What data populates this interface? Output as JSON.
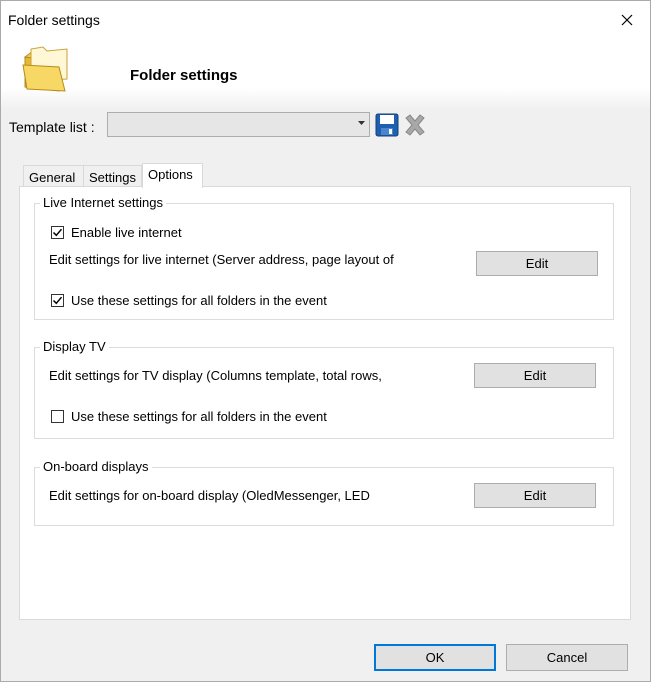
{
  "window": {
    "title": "Folder settings",
    "close_icon": "close-icon"
  },
  "header": {
    "icon": "folder-icon",
    "title": "Folder settings"
  },
  "template": {
    "label": "Template list :",
    "value": "",
    "save_icon": "save-icon",
    "delete_icon": "delete-icon"
  },
  "tabs": [
    {
      "label": "General",
      "active": false
    },
    {
      "label": "Settings",
      "active": false
    },
    {
      "label": "Options",
      "active": true
    }
  ],
  "live_internet": {
    "legend": "Live Internet settings",
    "enable_label": "Enable live internet",
    "enable_checked": true,
    "edit_description": "Edit settings for live internet (Server address, page layout of",
    "edit_button": "Edit",
    "all_folders_label": "Use these settings for all folders in the event",
    "all_folders_checked": true
  },
  "display_tv": {
    "legend": "Display TV",
    "edit_description": "Edit settings for TV display (Columns template, total rows,",
    "edit_button": "Edit",
    "all_folders_label": "Use these settings for all folders in the event",
    "all_folders_checked": false
  },
  "onboard": {
    "legend": "On-board displays",
    "edit_description": "Edit settings for on-board display (OledMessenger, LED",
    "edit_button": "Edit"
  },
  "footer": {
    "ok_label": "OK",
    "cancel_label": "Cancel"
  },
  "colors": {
    "accent": "#0078d7",
    "save_icon_blue": "#1f5fb0",
    "delete_icon_gray": "#9a9a9a",
    "folder_yellow": "#f7d864"
  }
}
